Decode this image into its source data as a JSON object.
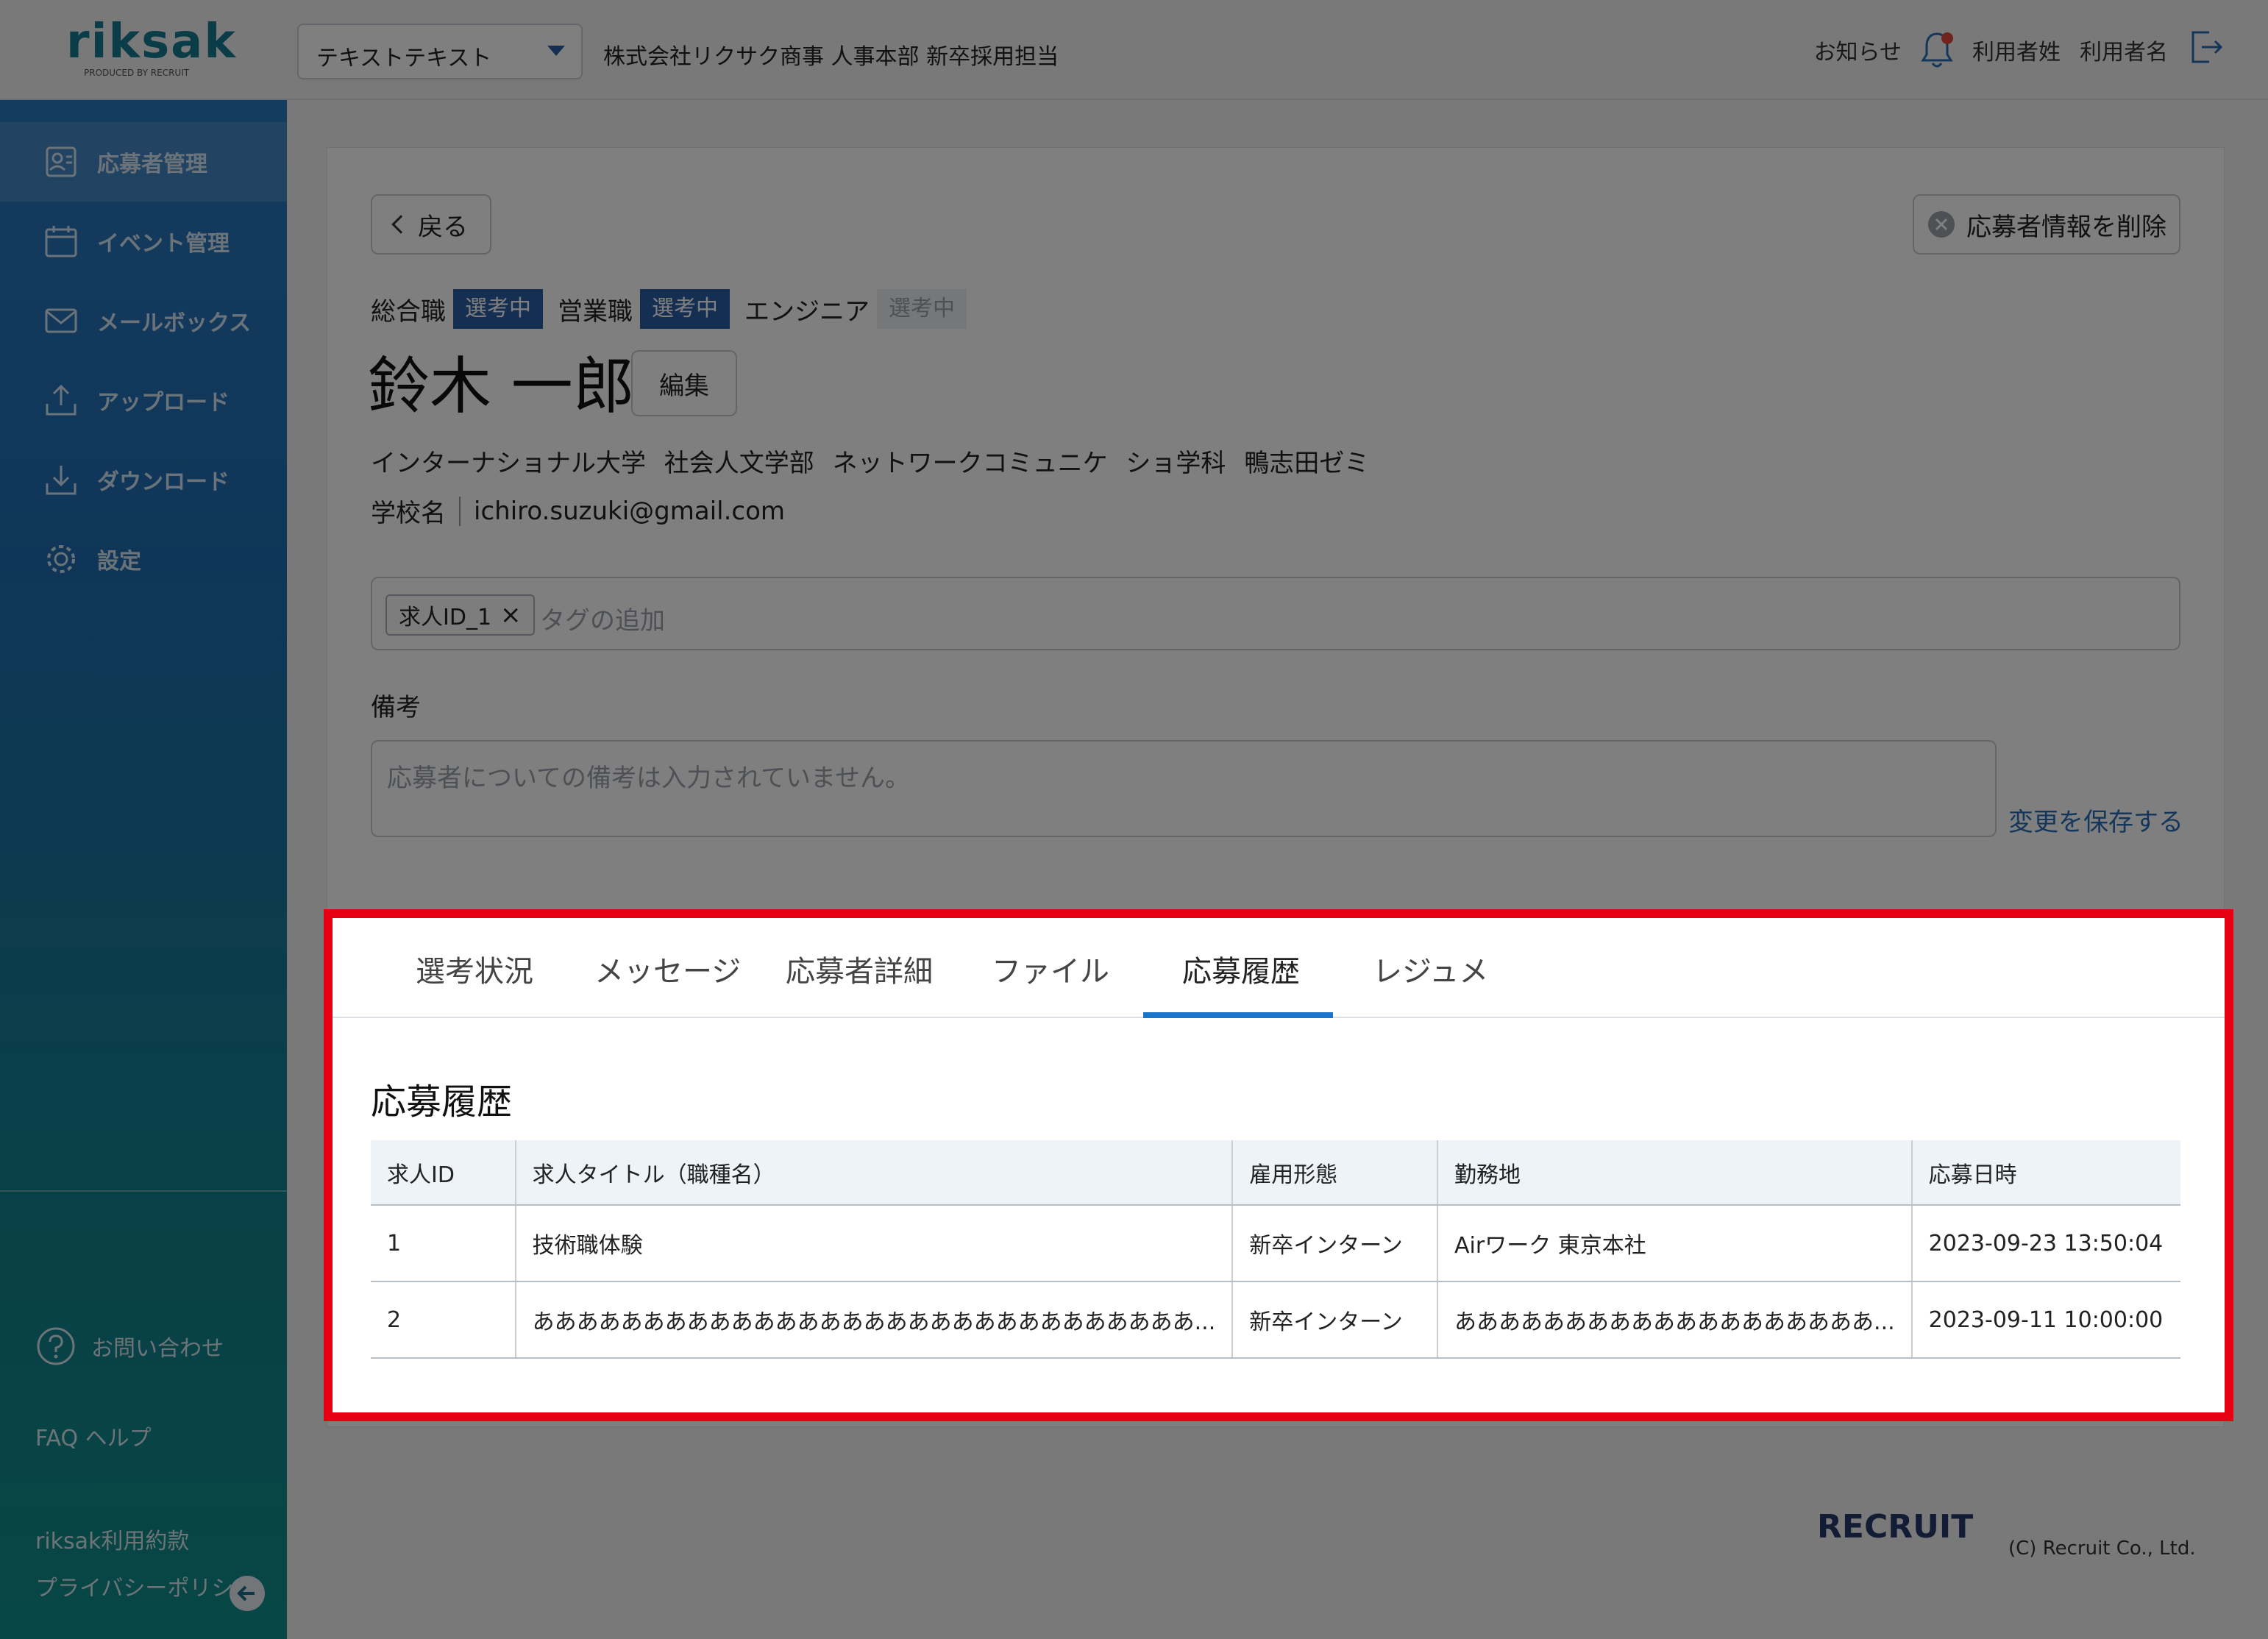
{
  "app": {
    "logo_text": "riksak",
    "logo_sub": "PRODUCED BY RECRUIT"
  },
  "header": {
    "company_select": "テキストテキスト",
    "department": "株式会社リクサク商事 人事本部 新卒採用担当",
    "notice": "お知らせ",
    "user_last": "利用者姓",
    "user_first": "利用者名"
  },
  "sidebar": {
    "items": [
      {
        "label": "応募者管理",
        "icon": "applicant-icon"
      },
      {
        "label": "イベント管理",
        "icon": "calendar-icon"
      },
      {
        "label": "メールボックス",
        "icon": "mail-icon"
      },
      {
        "label": "アップロード",
        "icon": "upload-icon"
      },
      {
        "label": "ダウンロード",
        "icon": "download-icon"
      },
      {
        "label": "設定",
        "icon": "gear-icon"
      }
    ],
    "contact": "お問い合わせ",
    "faq": "FAQ ヘルプ",
    "terms": "riksak利用約款",
    "privacy": "プライバシーポリシー"
  },
  "detail": {
    "back": "戻る",
    "delete": "応募者情報を削除",
    "jobs": [
      {
        "name": "総合職",
        "status": "選考中",
        "active": true
      },
      {
        "name": "営業職",
        "status": "選考中",
        "active": true
      },
      {
        "name": "エンジニア",
        "status": "選考中",
        "active": false
      }
    ],
    "applicant_name": "鈴木 一郎",
    "edit": "編集",
    "education": "インターナショナル大学 社会人文学部 ネットワークコミュニケ ショ学科 鴨志田ゼミ",
    "school_label": "学校名",
    "email": "ichiro.suzuki@gmail.com",
    "tag": "求人ID_1",
    "tag_placeholder": "タグの追加",
    "memo_label": "備考",
    "memo_placeholder": "応募者についての備考は入力されていません。",
    "save": "変更を保存する"
  },
  "tabs": [
    "選考状況",
    "メッセージ",
    "応募者詳細",
    "ファイル",
    "応募履歴",
    "レジュメ"
  ],
  "active_tab": "応募履歴",
  "history": {
    "title": "応募履歴",
    "columns": [
      "求人ID",
      "求人タイトル（職種名）",
      "雇用形態",
      "勤務地",
      "応募日時"
    ],
    "rows": [
      [
        "1",
        "技術職体験",
        "新卒インターン",
        "Airワーク 東京本社",
        "2023-09-23 13:50:04"
      ],
      [
        "2",
        "ああああああああああああああああああああああああああああああ...",
        "新卒インターン",
        "あああああああああああああああああああ...",
        "2023-09-11 10:00:00"
      ]
    ]
  },
  "footer": {
    "logo": "RECRUIT",
    "copyright": "(C) Recruit Co., Ltd."
  },
  "colors": {
    "highlight": "#e60012",
    "accent": "#1a74c9",
    "badge_active": "#2b5ea7"
  }
}
